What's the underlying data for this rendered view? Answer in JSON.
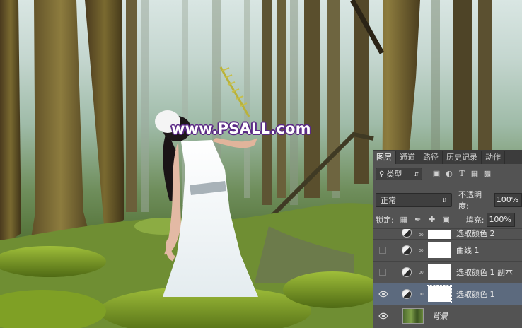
{
  "watermark": "www.PSALL.com",
  "panel": {
    "tabs": [
      "图层",
      "通道",
      "路径",
      "历史记录",
      "动作"
    ],
    "active_tab": "图层",
    "filter": {
      "label": "类型",
      "icon": "search-icon"
    },
    "filter_icons": [
      "image-filter-icon",
      "adjustment-filter-icon",
      "type-filter-icon",
      "shape-filter-icon",
      "smart-object-filter-icon"
    ],
    "blend_mode": "正常",
    "opacity_label": "不透明度:",
    "opacity_value": "100%",
    "lock_label": "锁定:",
    "lock_icons": [
      "lock-transparent-icon",
      "lock-paint-icon",
      "lock-move-icon",
      "lock-all-icon"
    ],
    "fill_label": "填充:",
    "fill_value": "100%",
    "layers": [
      {
        "name": "选取颜色 2",
        "visible": false,
        "selected": false
      },
      {
        "name": "曲线 1",
        "visible": false,
        "selected": false
      },
      {
        "name": "选取颜色 1 副本",
        "visible": false,
        "selected": false
      },
      {
        "name": "选取颜色 1",
        "visible": true,
        "selected": true
      },
      {
        "name": "背景",
        "visible": true,
        "selected": false
      }
    ]
  },
  "colors": {
    "panel_bg": "#535353",
    "selected_row": "#5c6a7e",
    "watermark_outline": "#5b2a86"
  }
}
